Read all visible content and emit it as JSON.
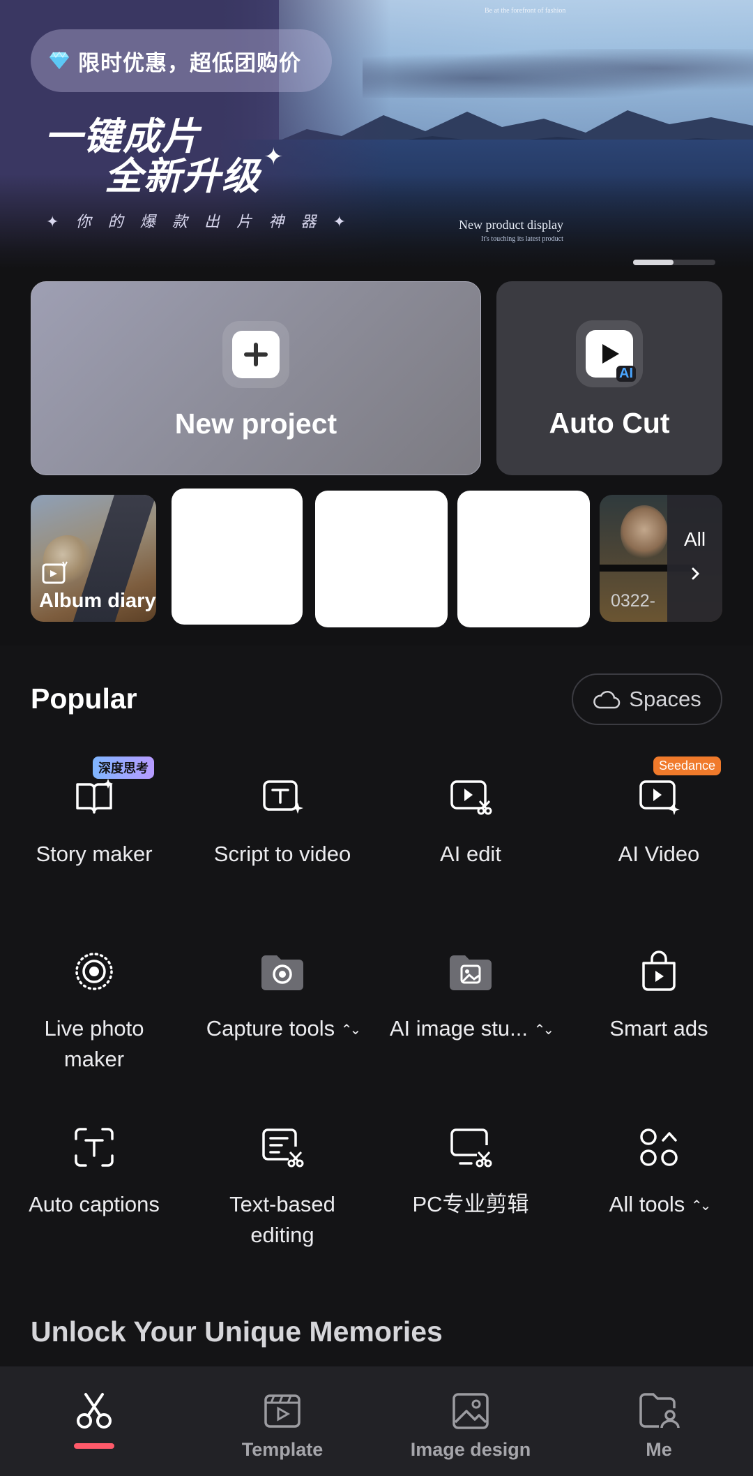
{
  "banner": {
    "promo": "限时优惠，超低团购价",
    "headline_1": "一键成片",
    "headline_2": "全新升级",
    "subline": "✦ 你 的 爆 款 出 片 神 器 ✦",
    "caption": "New product display",
    "caption_sub": "It's touching its latest product",
    "top_text": "Be at the forefront of fashion",
    "carousel": {
      "active_index": 0,
      "count": 2
    }
  },
  "cards": {
    "new_project": "New project",
    "auto_cut": "Auto Cut",
    "auto_cut_badge": "AI"
  },
  "recent": {
    "album_label": "Album diary",
    "last_label": "0322-",
    "all_label": "All"
  },
  "popular": {
    "title": "Popular",
    "spaces": "Spaces",
    "tools": [
      {
        "id": "story-maker",
        "label": "Story maker",
        "icon": "book-sparkle-icon",
        "badge": "深度思考"
      },
      {
        "id": "script-to-video",
        "label": "Script to video",
        "icon": "text-box-sparkle-icon"
      },
      {
        "id": "ai-edit",
        "label": "AI edit",
        "icon": "video-scissors-icon"
      },
      {
        "id": "ai-video",
        "label": "AI Video",
        "icon": "video-sparkle-icon",
        "badge": "Seedance"
      },
      {
        "id": "live-photo-maker",
        "label_1": "Live photo",
        "label_2": "maker",
        "icon": "live-photo-icon"
      },
      {
        "id": "capture-tools",
        "label": "Capture tools",
        "icon": "camera-folder-icon",
        "expand": "⌃⌄"
      },
      {
        "id": "ai-image-studio",
        "label": "AI image stu...",
        "icon": "image-folder-icon",
        "expand": "⌃⌄"
      },
      {
        "id": "smart-ads",
        "label": "Smart ads",
        "icon": "shopping-bag-play-icon"
      },
      {
        "id": "auto-captions",
        "label": "Auto captions",
        "icon": "caption-frame-icon"
      },
      {
        "id": "text-based-editing",
        "label_1": "Text-based",
        "label_2": "editing",
        "icon": "text-edit-scissors-icon"
      },
      {
        "id": "pc-pro-edit",
        "label": "PC专业剪辑",
        "icon": "monitor-scissors-icon"
      },
      {
        "id": "all-tools",
        "label": "All tools",
        "icon": "grid-circles-icon",
        "expand": "⌃⌄"
      }
    ]
  },
  "unlock_title": "Unlock Your Unique Memories",
  "nav": {
    "edit": "",
    "template": "Template",
    "image_design": "Image design",
    "me": "Me",
    "active": "edit"
  },
  "colors": {
    "background": "#121214",
    "accent_underline": "#ff5a6a",
    "badge_seedance": "#f07a2b"
  }
}
